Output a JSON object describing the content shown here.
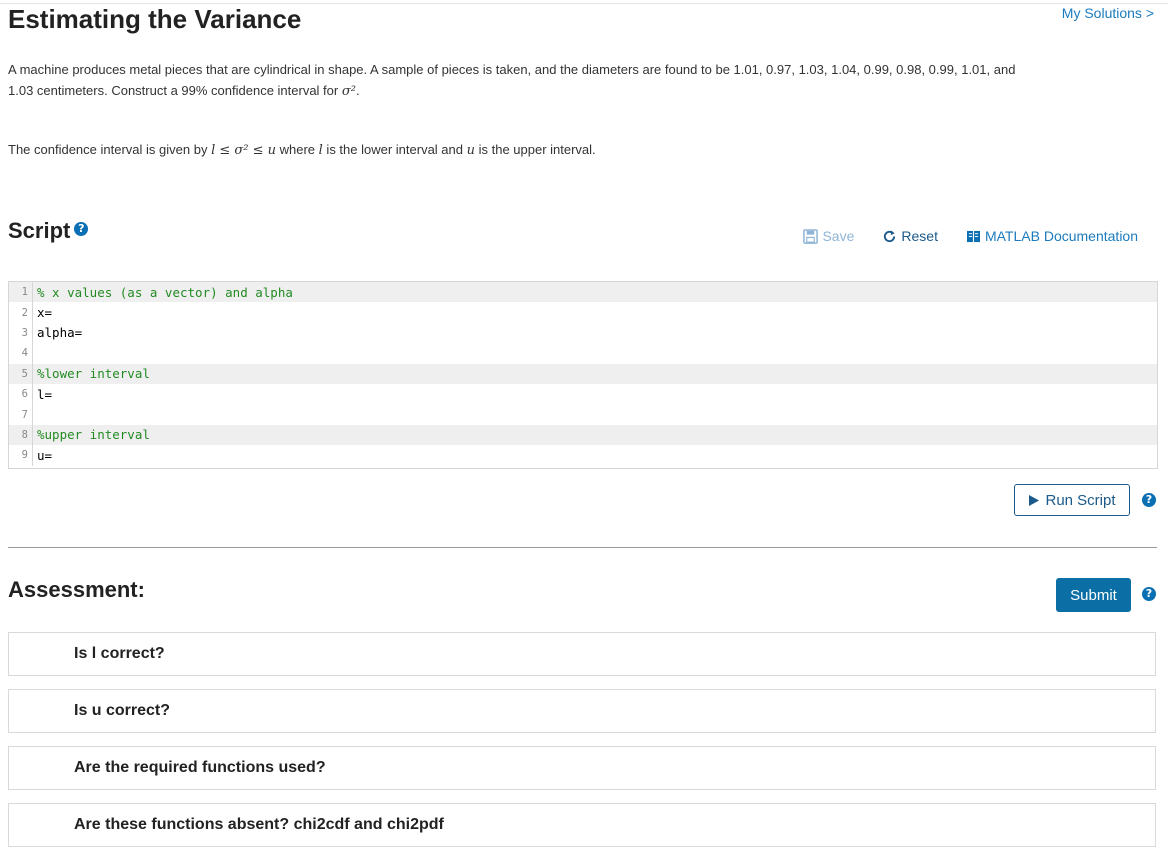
{
  "page": {
    "title": "Estimating the Variance",
    "my_solutions": "My Solutions >"
  },
  "problem": {
    "text_1": "A machine produces metal pieces that are cylindrical in shape. A sample of pieces is taken, and the diameters are found to be 1.01, 0.97, 1.03, 1.04, 0.99, 0.98, 0.99, 1.01, and",
    "text_2": "1.03 centimeters. Construct a 99% confidence interval for ",
    "sigma2": "σ²",
    "end_period": "."
  },
  "ci_sentence": {
    "prefix": "The confidence interval is given by ",
    "inequality": "l ≤ σ² ≤ u",
    "middle": " where ",
    "l": "l",
    "mid2": " is the lower interval and ",
    "u": "u",
    "suffix": " is the upper interval."
  },
  "script": {
    "heading": "Script",
    "toolbar": {
      "save": "Save",
      "reset": "Reset",
      "docs": "MATLAB Documentation"
    },
    "lines": [
      {
        "num": "1",
        "text": "% x values (as a vector) and alpha",
        "comment": true,
        "highlight": true
      },
      {
        "num": "2",
        "text": "x=",
        "comment": false,
        "highlight": false
      },
      {
        "num": "3",
        "text": "alpha=",
        "comment": false,
        "highlight": false
      },
      {
        "num": "4",
        "text": "",
        "comment": false,
        "highlight": false
      },
      {
        "num": "5",
        "text": "%lower interval",
        "comment": true,
        "highlight": true
      },
      {
        "num": "6",
        "text": "l=",
        "comment": false,
        "highlight": false
      },
      {
        "num": "7",
        "text": "",
        "comment": false,
        "highlight": false
      },
      {
        "num": "8",
        "text": "%upper interval",
        "comment": true,
        "highlight": true
      },
      {
        "num": "9",
        "text": "u=",
        "comment": false,
        "highlight": false
      }
    ],
    "run_label": "Run Script"
  },
  "assessment": {
    "heading": "Assessment:",
    "submit_label": "Submit",
    "tests": [
      "Is l correct?",
      "Is u correct?",
      "Are the required functions used?",
      "Are these functions absent? chi2cdf and chi2pdf"
    ]
  },
  "colors": {
    "link": "#1b7bbd",
    "submit_bg": "#0b6fa6",
    "comment": "#228b22"
  }
}
